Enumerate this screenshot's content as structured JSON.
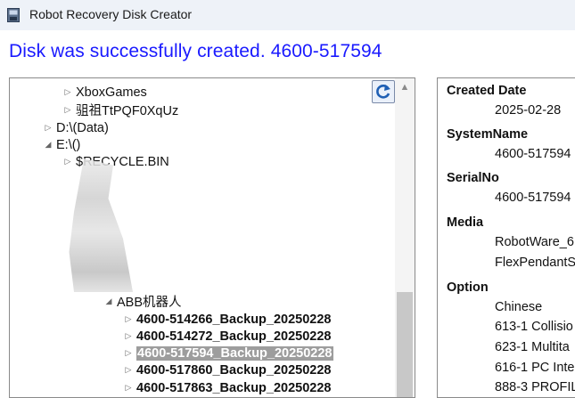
{
  "window": {
    "title": "Robot Recovery Disk Creator"
  },
  "message": "Disk was successfully created. 4600-517594",
  "tree": [
    {
      "label": "XboxGames",
      "indent": 58,
      "expanded": false,
      "bold": false,
      "selected": false
    },
    {
      "label": "驵祖TtPQF0XqUz",
      "indent": 58,
      "expanded": false,
      "bold": false,
      "selected": false
    },
    {
      "label": "D:\\(Data)",
      "indent": 36,
      "expanded": false,
      "bold": false,
      "selected": false
    },
    {
      "label": "E:\\()",
      "indent": 36,
      "expanded": true,
      "bold": false,
      "selected": false
    },
    {
      "label": "$RECYCLE.BIN",
      "indent": 58,
      "expanded": false,
      "bold": false,
      "selected": false
    },
    {
      "label": "ABB机器人",
      "indent": 104,
      "expanded": true,
      "bold": false,
      "selected": false
    },
    {
      "label": "4600-514266_Backup_20250228",
      "indent": 126,
      "expanded": false,
      "bold": true,
      "selected": false
    },
    {
      "label": "4600-514272_Backup_20250228",
      "indent": 126,
      "expanded": false,
      "bold": true,
      "selected": false
    },
    {
      "label": "4600-517594_Backup_20250228",
      "indent": 126,
      "expanded": false,
      "bold": true,
      "selected": true
    },
    {
      "label": "4600-517860_Backup_20250228",
      "indent": 126,
      "expanded": false,
      "bold": true,
      "selected": false
    },
    {
      "label": "4600-517863_Backup_20250228",
      "indent": 126,
      "expanded": false,
      "bold": true,
      "selected": false
    }
  ],
  "info": {
    "created_date_label": "Created Date",
    "created_date": "2025-02-28",
    "system_name_label": "SystemName",
    "system_name": "4600-517594",
    "serial_no_label": "SerialNo",
    "serial_no": "4600-517594",
    "media_label": "Media",
    "media": [
      "RobotWare_6",
      "FlexPendantS"
    ],
    "option_label": "Option",
    "options": [
      "Chinese",
      "613-1 Collisio",
      "623-1 Multita",
      "616-1 PC Inte",
      "888-3 PROFIL"
    ]
  },
  "icons": {
    "app": "disk-app-icon",
    "refresh": "refresh-icon",
    "expand_arrow": "expand-arrow-icon",
    "collapse_arrow": "collapse-arrow-icon",
    "scroll_up": "scroll-up-icon"
  },
  "colors": {
    "heading": "#1a1aff",
    "selection": "#9d9d9d",
    "titlebar": "#eef2f8"
  }
}
